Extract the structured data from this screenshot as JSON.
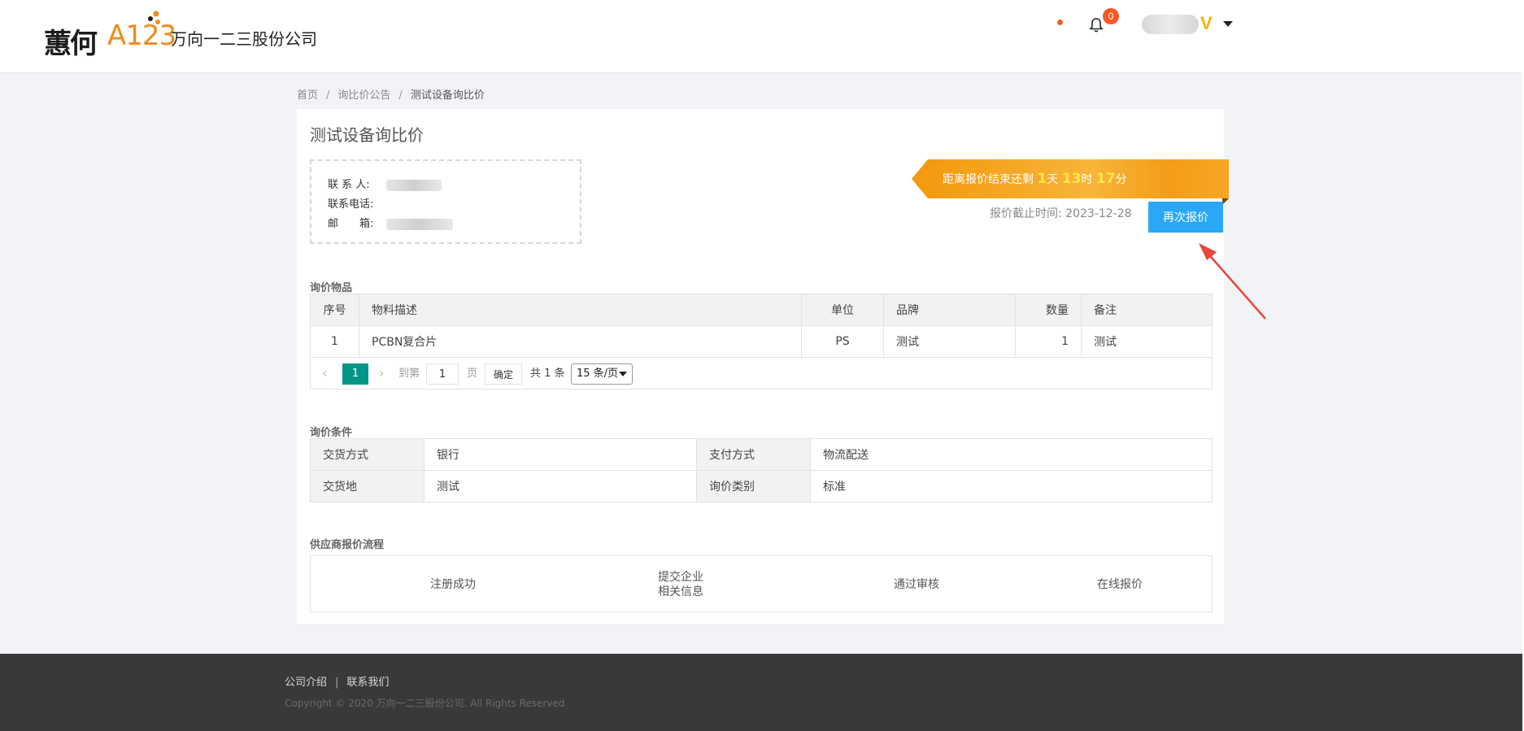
{
  "header": {
    "logo_mark": "蕙何",
    "logo_number": "A123",
    "company_name": "万向一二三股份公司",
    "notification_count": "0",
    "vip_badge": "V"
  },
  "breadcrumb": {
    "home": "首页",
    "notice": "询比价公告",
    "current": "测试设备询比价",
    "separator": "/"
  },
  "card": {
    "title": "测试设备询比价",
    "contact": {
      "person_label": "联 系 人:",
      "phone_label": "联系电话:",
      "email_label": "邮　　箱:"
    },
    "countdown": {
      "prefix": "距离报价结束还剩",
      "days": "1",
      "days_unit": "天",
      "hours": "13",
      "hours_unit": "时",
      "minutes": "17",
      "minutes_unit": "分"
    },
    "deadline_label": "报价截止时间:",
    "deadline_value": "2023-12-28",
    "requote_button": "再次报价"
  },
  "items": {
    "section_title": "询价物品",
    "headers": [
      "序号",
      "物料描述",
      "单位",
      "品牌",
      "数量",
      "备注"
    ],
    "rows": [
      [
        "1",
        "PCBN复合片",
        "PS",
        "测试",
        "1",
        "测试"
      ]
    ],
    "pager": {
      "prev": "‹",
      "current_page": "1",
      "next": "›",
      "goto_label": "到第",
      "goto_value": "1",
      "page_unit": "页",
      "confirm": "确定",
      "total": "共 1 条",
      "page_size": "15 条/页"
    }
  },
  "conditions": {
    "section_title": "询价条件",
    "rows": [
      {
        "k1": "交货方式",
        "v1": "银行",
        "k2": "支付方式",
        "v2": "物流配送"
      },
      {
        "k1": "交货地",
        "v1": "测试",
        "k2": "询价类别",
        "v2": "标准"
      }
    ]
  },
  "flow": {
    "section_title": "供应商报价流程",
    "steps": [
      "注册成功",
      "提交企业",
      "相关信息",
      "通过审核",
      "在线报价"
    ]
  },
  "footer": {
    "link_about": "公司介绍",
    "link_contact": "联系我们",
    "separator": "|",
    "copyright": "Copyright © 2020 万向一二三股份公司. All Rights Reserved"
  },
  "colors": {
    "accent_blue": "#2aa8f5",
    "countdown_orange": "#f39a10",
    "pager_green": "#009688",
    "footer_bg": "#393939"
  }
}
